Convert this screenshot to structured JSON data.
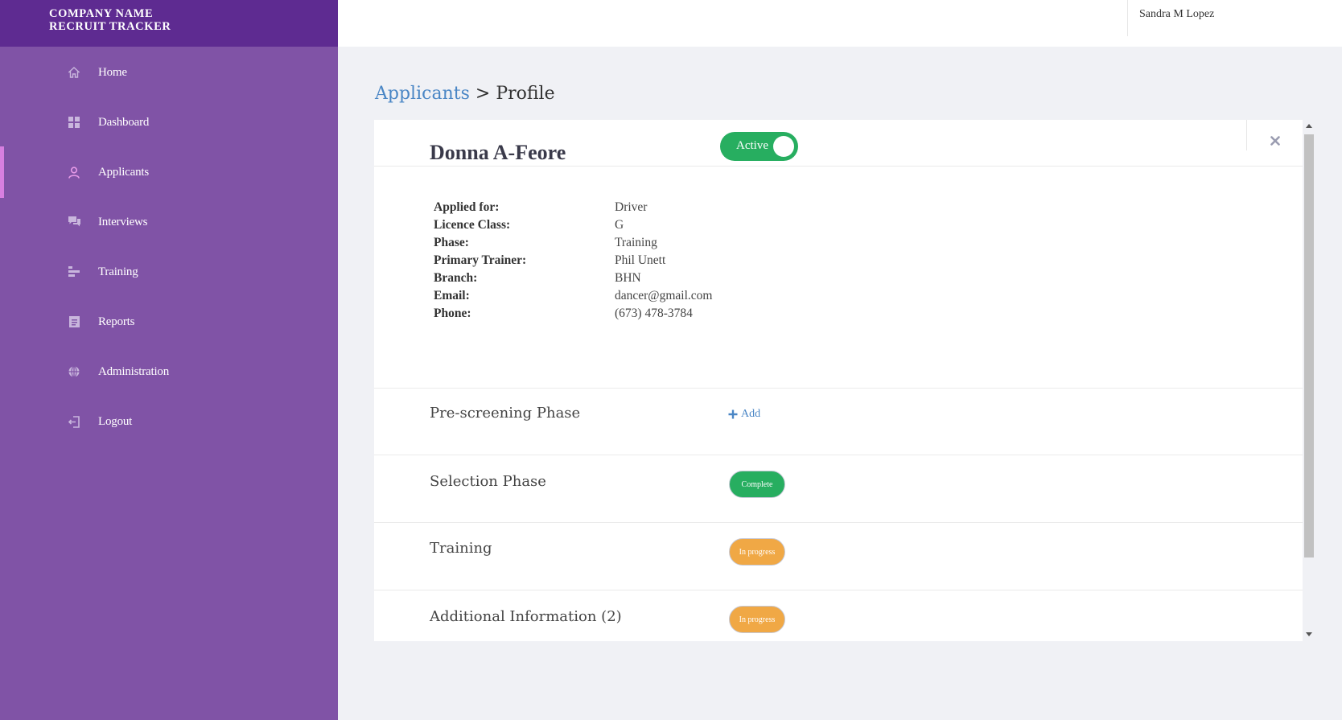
{
  "brand": {
    "line1": "COMPANY NAME",
    "line2": "RECRUIT TRACKER",
    "color": "#5e2b91"
  },
  "sidebar": {
    "color": "#8053a6",
    "items": [
      {
        "label": "Home",
        "icon": "home-icon"
      },
      {
        "label": "Dashboard",
        "icon": "dashboard-icon"
      },
      {
        "label": "Applicants",
        "icon": "user-icon",
        "active": true
      },
      {
        "label": "Interviews",
        "icon": "chat-icon"
      },
      {
        "label": "Training",
        "icon": "training-icon"
      },
      {
        "label": "Reports",
        "icon": "report-icon"
      },
      {
        "label": "Administration",
        "icon": "globe-icon"
      },
      {
        "label": "Logout",
        "icon": "logout-icon"
      }
    ]
  },
  "header": {
    "user_name": "Sandra M Lopez"
  },
  "breadcrumb": {
    "link": "Applicants",
    "separator": ">",
    "current": "Profile"
  },
  "profile": {
    "name": "Donna A-Feore",
    "status_toggle": "Active",
    "details": [
      {
        "label": "Applied for:",
        "value": "Driver"
      },
      {
        "label": "Licence Class:",
        "value": "G"
      },
      {
        "label": "Phase:",
        "value": "Training"
      },
      {
        "label": "Primary Trainer:",
        "value": "Phil Unett"
      },
      {
        "label": "Branch:",
        "value": "BHN"
      },
      {
        "label": "Email:",
        "value": "dancer@gmail.com"
      },
      {
        "label": "Phone:",
        "value": "(673) 478-3784"
      }
    ]
  },
  "phases": [
    {
      "title": "Pre-screening Phase",
      "action": "Add"
    },
    {
      "title": "Selection Phase",
      "status": "Complete",
      "status_color": "#27ae60"
    },
    {
      "title": "Training",
      "status": "In progress",
      "status_color": "#f0a845"
    },
    {
      "title": "Additional Information (2)",
      "status": "In progress",
      "status_color": "#f0a845"
    }
  ]
}
